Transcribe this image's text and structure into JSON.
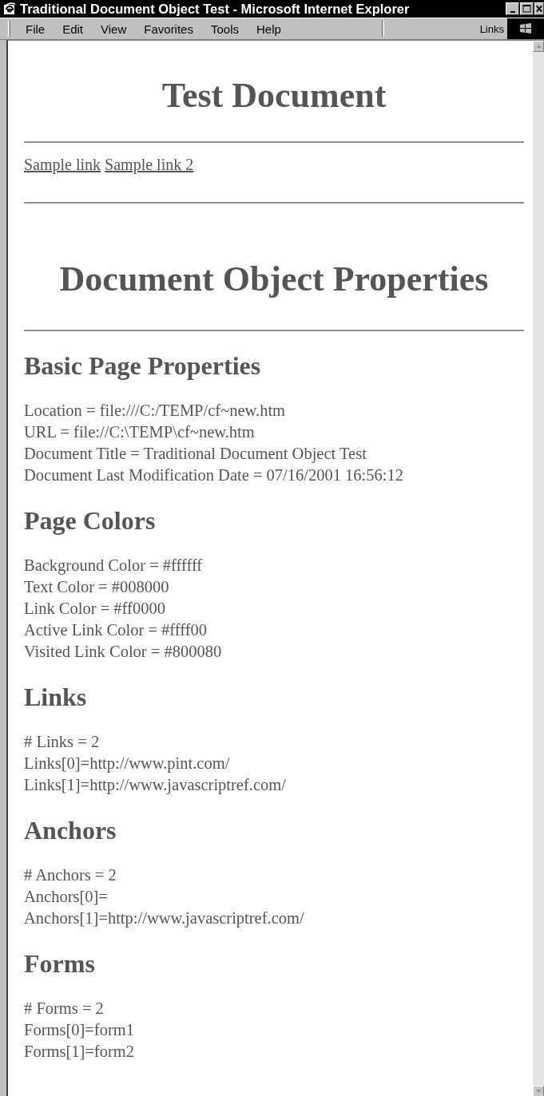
{
  "window": {
    "title": "Traditional Document Object Test - Microsoft Internet Explorer"
  },
  "menu": [
    {
      "label": "File"
    },
    {
      "label": "Edit"
    },
    {
      "label": "View"
    },
    {
      "label": "Favorites"
    },
    {
      "label": "Tools"
    },
    {
      "label": "Help"
    }
  ],
  "links_bar": {
    "label": "Links"
  },
  "page": {
    "title": "Test Document",
    "links": [
      "Sample link",
      "Sample link 2"
    ],
    "heading": "Document Object Properties",
    "sections": [
      {
        "heading": "Basic Page Properties",
        "lines": [
          "Location = file:///C:/TEMP/cf~new.htm",
          "URL = file://C:\\TEMP\\cf~new.htm",
          "Document Title = Traditional Document Object Test",
          "Document Last Modification Date = 07/16/2001 16:56:12"
        ]
      },
      {
        "heading": "Page Colors",
        "lines": [
          "Background Color = #ffffff",
          "Text Color = #008000",
          "Link Color = #ff0000",
          "Active Link Color = #ffff00",
          "Visited Link Color = #800080"
        ]
      },
      {
        "heading": "Links",
        "lines": [
          "# Links = 2",
          "Links[0]=http://www.pint.com/",
          "Links[1]=http://www.javascriptref.com/"
        ]
      },
      {
        "heading": "Anchors",
        "lines": [
          "# Anchors = 2",
          "Anchors[0]=",
          "Anchors[1]=http://www.javascriptref.com/"
        ]
      },
      {
        "heading": "Forms",
        "lines": [
          "# Forms = 2",
          "Forms[0]=form1",
          "Forms[1]=form2"
        ]
      }
    ]
  }
}
